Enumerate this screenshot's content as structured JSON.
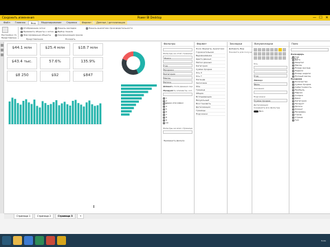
{
  "app": {
    "title_left": "Сохранить изменения",
    "title_center": "Power BI Desktop",
    "controls": [
      "—",
      "☐",
      "✕"
    ]
  },
  "ribbon_tabs": [
    "Файл",
    "Главная",
    "Вид",
    "Моделирование",
    "Справка",
    "Формат",
    "Данные / детализация"
  ],
  "ribbon": {
    "ribbon_group_label": "Настройки страницы",
    "scale_label": "Представление",
    "checkboxes": [
      "Отображение сетки",
      "Привязать объекты к сетке",
      "Фиксированные объекты",
      "Панель закладок",
      "Выбор панели",
      "Синхронизация срезов",
      "Панель аналитики производительности"
    ],
    "section_labels": [
      "Представление",
      "Показать"
    ]
  },
  "kpis": [
    {
      "value": "$44.1 млн",
      "label": "Sales Amount"
    },
    {
      "value": "$25.4 млн",
      "label": "Total Cost"
    },
    {
      "value": "$18.7 млн",
      "label": "Profit"
    },
    {
      "value": "$43.4 тыс.",
      "label": "Average"
    },
    {
      "value": "57.6%",
      "label": "Margin"
    },
    {
      "value": "135.9%",
      "label": "Growth"
    },
    {
      "value": "$8 250",
      "label": "Min"
    },
    {
      "value": "$92",
      "label": "Avg"
    },
    {
      "value": "$847",
      "label": "Max"
    }
  ],
  "colors": {
    "teal": "#20b2aa",
    "red": "#f05a5a",
    "dark": "#333b41",
    "powerbi_yellow": "#f2c811"
  },
  "filters_pane": {
    "title": "Фильтры",
    "search": "Поиск",
    "section_page": "Фильтры на этой странице",
    "section_all": "Фильтры на всех страницах",
    "add_field": "Добавить поля данных сюда",
    "filter_items": [
      "Год",
      "Продажи",
      "Категория",
      "Месяц",
      "Регион",
      "Клиент",
      "Продукт"
    ],
    "condition_label": "Показывать элементы, когда значение",
    "condition_value": "больше или равно",
    "values_list": [
      "1",
      "2",
      "3",
      "4",
      "5",
      "6",
      "7",
      "8",
      "9",
      "10"
    ],
    "apply_button": "Применить фильтр"
  },
  "format_pane": {
    "title": "Формат",
    "tabs": [
      "Поля",
      "Форматы",
      "Аналитика"
    ],
    "items": [
      "Горизонтальная",
      "Выравнивание",
      "Цвета данных",
      "Метки данных",
      "Категория",
      "Сумма продаж",
      "Ось X",
      "Ось Y",
      "Легенда",
      "Заголовок",
      "Фон",
      "Граница",
      "Общие",
      "Всплывающие",
      "Визуальный",
      "Восстановить",
      "Детализация",
      "Границы",
      "Подсказки"
    ]
  },
  "synonyms_pane": {
    "title": "Закладки",
    "buttons": [
      "Добавить",
      "Вид",
      "Эти"
    ],
    "hint": "Нажмите для получения дополнительной информации"
  },
  "viz_pane": {
    "title": "Визуализации",
    "sections": [
      "Ось",
      "Легенда",
      "Значения",
      "Подсказки",
      "Детализация",
      "Сохранять все фильтры"
    ],
    "value_items": [
      "Год",
      "Месяц",
      "День",
      "Сумма продаж"
    ],
    "toggle_label": "Вкл."
  },
  "fields_pane": {
    "title": "Поля",
    "search": "Поиск",
    "tables": [
      {
        "name": "Календарь",
        "fields": [
          "Год",
          "Дата",
          "Квартал",
          "Месяц",
          "Номер месяца",
          "Неделя",
          "Номер недели",
          "Полный месяц"
        ]
      },
      {
        "name": "Продажи",
        "fields": [
          "Количество",
          "Сумма продаж",
          "Себестоимость",
          "Прибыль",
          "Маржа",
          "Скидка",
          "Цена",
          "Категория",
          "Продукт",
          "Регион",
          "Клиент",
          "Продавец",
          "Город",
          "Страна",
          "Тип"
        ]
      }
    ]
  },
  "page_tabs": [
    "Страница 1",
    "Страница 2",
    "Страница 3",
    "+"
  ],
  "chart_data": [
    {
      "type": "donut",
      "title": "",
      "values": [
        43,
        38,
        19
      ],
      "colors": [
        "#20b2aa",
        "#333b41",
        "#f05a5a"
      ],
      "labels": []
    },
    {
      "type": "bar",
      "orientation": "horizontal",
      "categories": [
        "",
        "",
        "",
        "",
        "",
        "",
        "",
        "",
        "",
        ""
      ],
      "values": [
        100,
        86,
        76,
        64,
        58,
        50,
        42,
        36,
        30,
        24
      ]
    },
    {
      "type": "bar",
      "orientation": "vertical",
      "categories": [],
      "values": [
        72,
        84,
        80,
        67,
        62,
        74,
        79,
        69,
        64,
        78,
        58,
        53,
        73,
        67,
        61,
        64,
        70,
        76,
        60,
        66,
        71,
        63,
        59,
        74,
        77,
        67,
        62,
        56,
        69,
        75,
        63,
        58,
        60,
        66
      ]
    }
  ],
  "taskbar": {
    "time": "5:41"
  }
}
